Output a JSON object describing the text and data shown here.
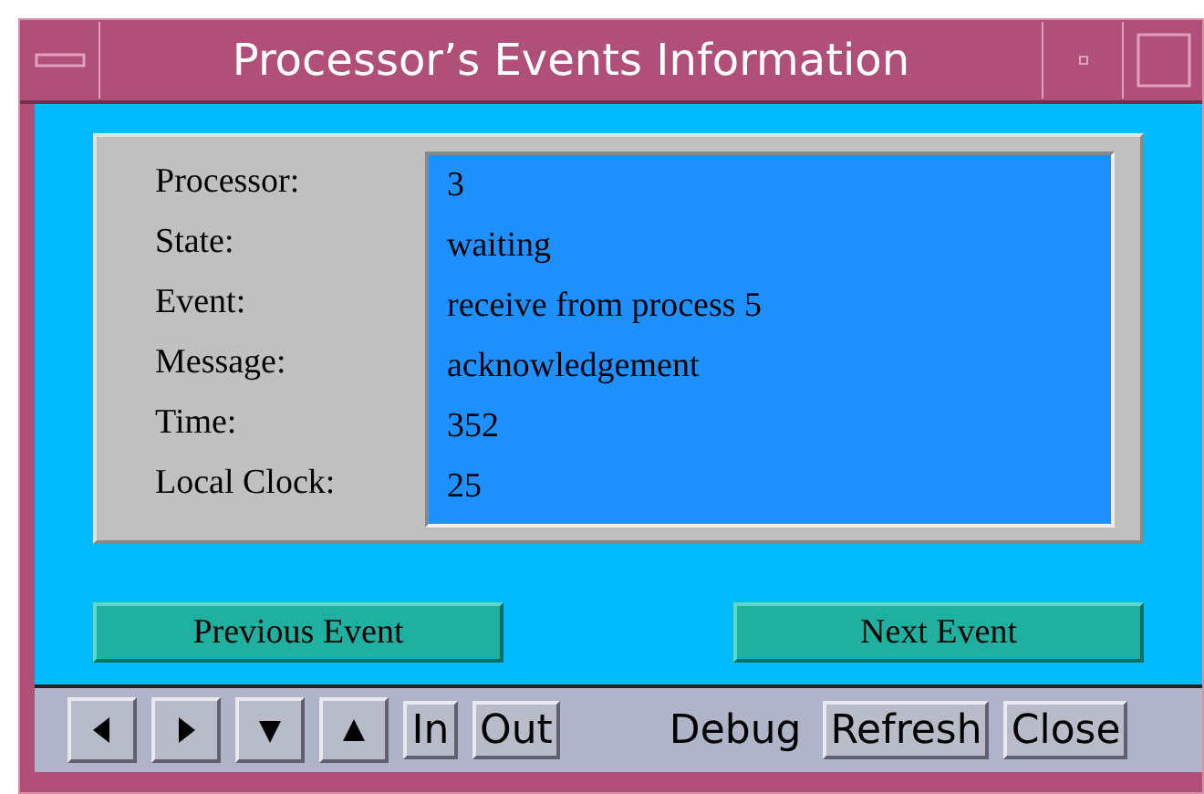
{
  "window": {
    "title": "Processor’s  Events Information"
  },
  "fields": [
    {
      "label": "Processor:",
      "value": "3"
    },
    {
      "label": "State:",
      "value": "waiting"
    },
    {
      "label": "Event:",
      "value": "receive from  process 5"
    },
    {
      "label": "Message:",
      "value": "acknowledgement"
    },
    {
      "label": "Time:",
      "value": "352"
    },
    {
      "label": "Local Clock:",
      "value": "25"
    }
  ],
  "nav_buttons": [
    "Previous Event",
    "Next Event"
  ],
  "toolbar": {
    "arrows": [
      {
        "kind": "left"
      },
      {
        "kind": "right"
      },
      {
        "kind": "down"
      },
      {
        "kind": "up"
      }
    ],
    "zoom_buttons": [
      "In",
      "Out"
    ],
    "label": "Debug",
    "buttons": [
      "Refresh",
      "Close"
    ]
  }
}
